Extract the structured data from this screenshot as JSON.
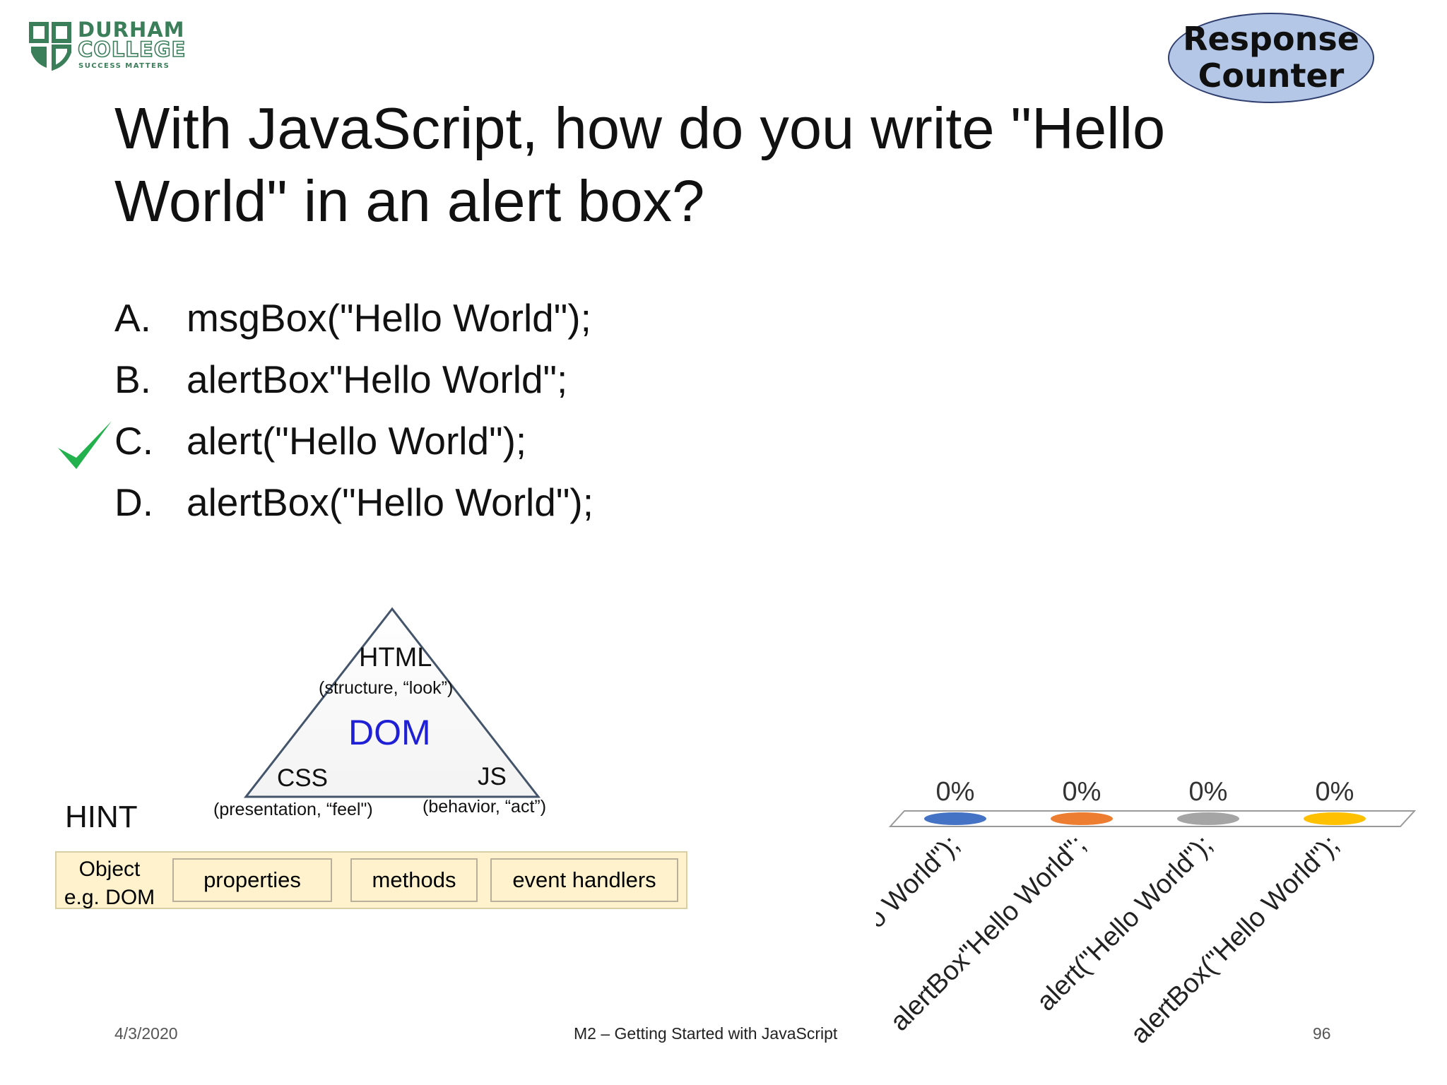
{
  "logo": {
    "line1": "DURHAM",
    "line2": "COLLEGE",
    "tagline": "SUCCESS MATTERS"
  },
  "response_counter": {
    "line1": "Response",
    "line2": "Counter"
  },
  "question": {
    "line1": "With JavaScript, how do you write \"Hello",
    "line2": "World\" in an alert box?"
  },
  "options": [
    {
      "letter": "A.",
      "text": "msgBox(\"Hello World\");",
      "correct": false
    },
    {
      "letter": "B.",
      "text": "alertBox\"Hello World\";",
      "correct": false
    },
    {
      "letter": "C.",
      "text": "alert(\"Hello World\");",
      "correct": true
    },
    {
      "letter": "D.",
      "text": "alertBox(\"Hello World\");",
      "correct": false
    }
  ],
  "triangle": {
    "html": "HTML",
    "html_sub": "(structure, “look”)",
    "center": "DOM",
    "css": "CSS",
    "css_sub": "(presentation, “feel\")",
    "js": "JS",
    "js_sub": "(behavior, “act”)"
  },
  "hint": {
    "label": "HINT",
    "object_line1": "Object",
    "object_line2": "e.g. DOM",
    "cells": [
      "properties",
      "methods",
      "event handlers"
    ]
  },
  "chart_data": {
    "type": "bar",
    "categories": [
      "msgBox(\"Hello World\");",
      "alertBox\"Hello World\";",
      "alert(\"Hello World\");",
      "alertBox(\"Hello World\");"
    ],
    "values": [
      0,
      0,
      0,
      0
    ],
    "data_labels": [
      "0%",
      "0%",
      "0%",
      "0%"
    ],
    "colors": [
      "#4472c4",
      "#ed7d31",
      "#a5a5a5",
      "#ffc000"
    ],
    "ylim": [
      0,
      100
    ]
  },
  "footer": {
    "date": "4/3/2020",
    "title": "M2 – Getting Started with JavaScript",
    "page": "96"
  },
  "colors": {
    "dom_blue": "#1f1fd6",
    "check_green": "#22b14c",
    "hint_fill": "#fff2cc",
    "logo_green": "#3a7f5a"
  }
}
